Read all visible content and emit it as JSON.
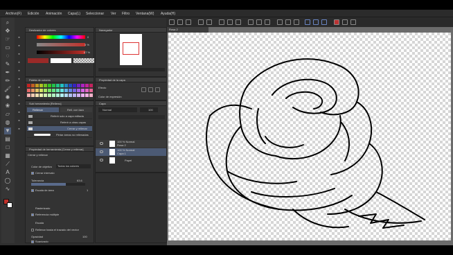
{
  "menu": [
    "Archivo(F)",
    "Edición",
    "Animación",
    "Capa(L)",
    "Seleccionar",
    "Ver",
    "Filtro",
    "Ventana(W)",
    "Ayuda(H)"
  ],
  "colors": {
    "accent": "#4c5a74",
    "main_color": "#c0302a",
    "sub_color": "#ffffff",
    "hue_bar": "#9a2a28"
  },
  "color_panel": {
    "title": "Deslizador de colores",
    "slider1_value": "0",
    "slider2_value": "5 %",
    "slider3_value": "67 %"
  },
  "navigator": {
    "title": "Navegador"
  },
  "palette": {
    "title": "Paleta de colores"
  },
  "sub_tool_panel": {
    "title": "Sub herramienta [Relleno]",
    "tab1": "Rellenar",
    "tab2": "Rell. con lazo",
    "items": [
      "Referir solo a capa editada",
      "Referir a otras capas",
      "Cerrar y rellenar",
      "Pintar áreas no rellenadas"
    ]
  },
  "layer_property": {
    "title": "Propiedad de la capa",
    "effect_label": "Efecto",
    "expression_label": "Color de expresión",
    "expression_value": "Color"
  },
  "layers_panel": {
    "title": "Capa",
    "blend_mode": "Normal",
    "opacity": "100",
    "layers": [
      {
        "line1": "100 % Normal",
        "line2": "Rosa 2"
      },
      {
        "line1": "100 % Normal",
        "line2": "Capa 1"
      },
      {
        "line1": "",
        "line2": "Papel"
      }
    ]
  },
  "tool_property": {
    "title": "Propiedad de herramienta [Cerrar y rellenar]",
    "subtitle": "Cerrar y rellenar",
    "target_label": "Color de objetivo",
    "target_value": "Todos los colores",
    "close_gaps": "Cerrar intervalo",
    "tolerance_label": "Tolerancia",
    "tolerance_value": "63.6",
    "expand_label": "Escala de área",
    "expand_value": "1",
    "fill_section": "Rasterizado",
    "multi_ref": "Referencia múltiple",
    "area_label": "Escala",
    "refer_vector": "Rellenar hasta el trazado del vector",
    "opacity_label": "Opacidad",
    "opacity_value": "100",
    "antialias": "Suavizado"
  },
  "canvas": {
    "tab_label": "Rosa 2"
  },
  "icons": [
    "pen-icon",
    "pencil-icon",
    "brush-icon",
    "fill-icon",
    "eraser-icon",
    "text-icon",
    "move-icon",
    "zoom-icon",
    "hand-icon",
    "eyedropper-icon",
    "selection-icon",
    "gradient-icon"
  ]
}
